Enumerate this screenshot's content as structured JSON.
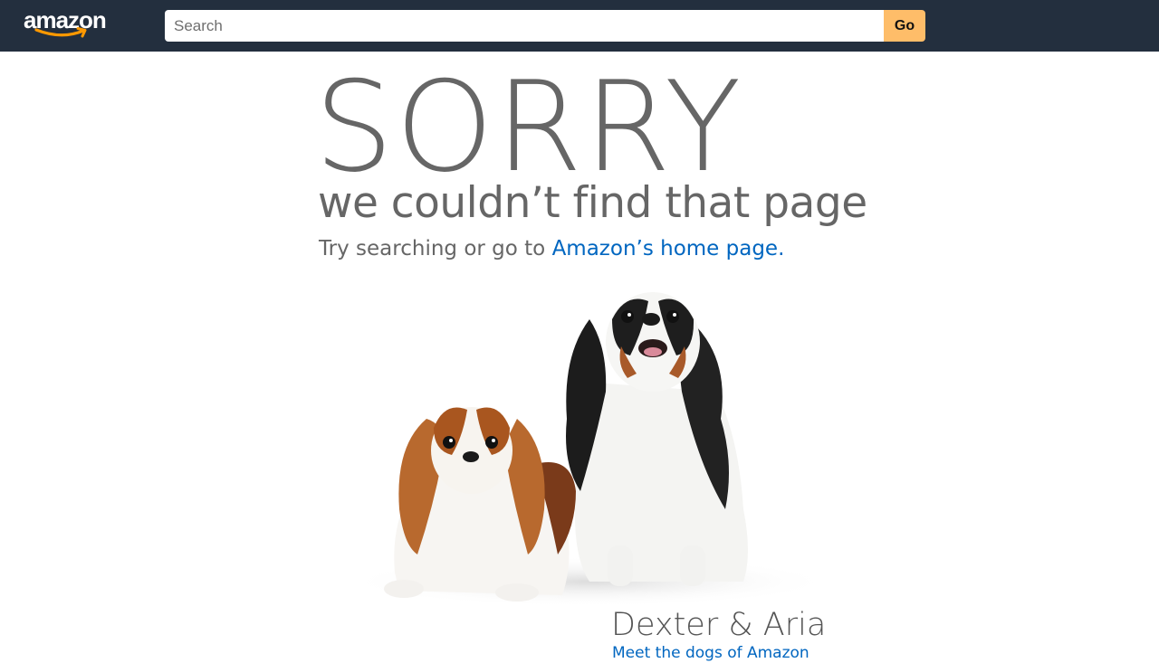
{
  "header": {
    "logo_text": "amazon",
    "search_placeholder": "Search",
    "search_value": "",
    "go_label": "Go",
    "background_color": "#232f3e",
    "go_button_color": "#febd69"
  },
  "error": {
    "headline": "SORRY",
    "subtitle": "we couldn’t find that page",
    "try_text": "Try searching or go to ",
    "home_link_text": "Amazon’s home page.",
    "link_color": "#0066c0"
  },
  "dogs": {
    "caption": "Dexter & Aria",
    "meet_link_text": "Meet the dogs of Amazon"
  }
}
